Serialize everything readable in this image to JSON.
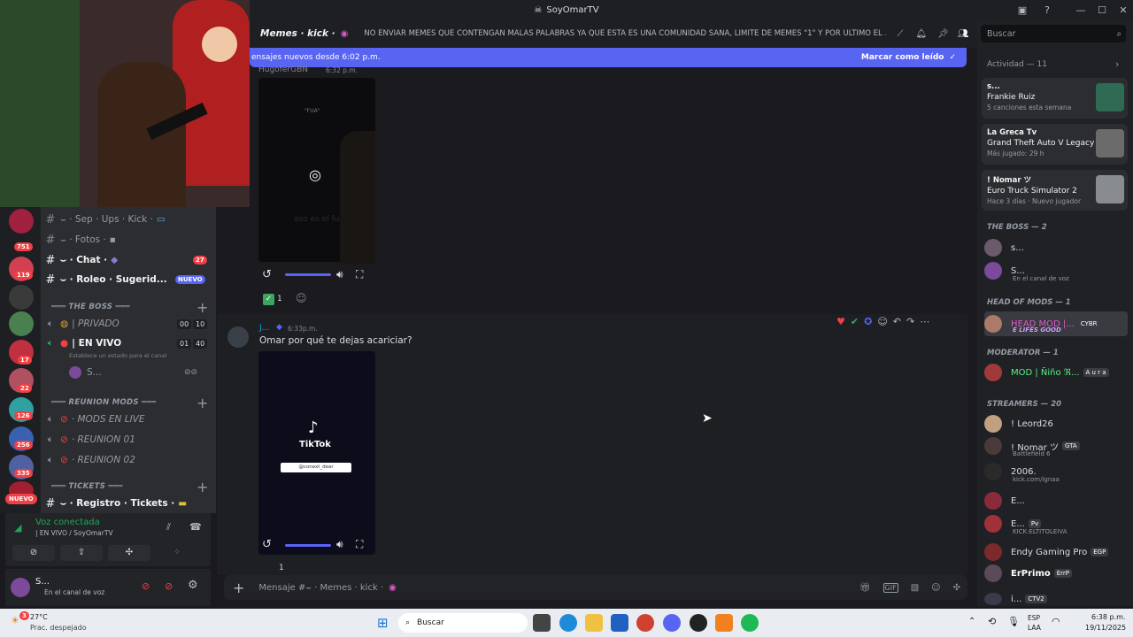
{
  "window": {
    "title": "SoyOmarTV"
  },
  "header": {
    "channel_name": "Memes · kick ·",
    "topic": "NO ENVIAR MEMES QUE CONTENGAN MALAS PALABRAS YA QUE ESTA ES UNA COMUNIDAD SANA, LIMITE DE MEMES \"1\" Y POR ULTIMO EL ..."
  },
  "search": {
    "placeholder": "Buscar"
  },
  "new_messages_bar": {
    "text": "ensajes nuevos desde 6:02 p.m.",
    "action": "Marcar como leído"
  },
  "servers": [
    {
      "badge": "751"
    },
    {
      "badge": "119"
    },
    {
      "badge": ""
    },
    {
      "badge": "17"
    },
    {
      "badge": "22"
    },
    {
      "badge": "126"
    },
    {
      "badge": "256"
    },
    {
      "badge": "335"
    },
    {
      "badge": "NUEVO"
    }
  ],
  "channels": [
    {
      "name": "⌣ · Sep · Ups · Kick ·",
      "badge": ""
    },
    {
      "name": "⌣ · Fotos ·",
      "badge": ""
    },
    {
      "name": "⌣ · Chat ·",
      "badge": "27"
    },
    {
      "name": "⌣ · Roleo · Sugerid...",
      "badge": "NUEVO"
    }
  ],
  "categories": {
    "boss": "═══ THE BOSS ═══",
    "reunion": "═══ REUNION MODS ═══",
    "tickets": "═══ TICKETS ═══"
  },
  "voice_channels": [
    {
      "name": "| PRIVADO",
      "c1": "00",
      "c2": "10"
    },
    {
      "name": "| EN VIVO",
      "c1": "01",
      "c2": "40"
    }
  ],
  "voice_status_hint": "Establece un estado para el canal",
  "voice_member": "S...",
  "reunion_channels": [
    "· MODS EN LIVE",
    "· REUNION 01",
    "· REUNION 02"
  ],
  "ticket_channel": "⌣ · Registro · Tickets ·",
  "voice_panel": {
    "status": "Voz conectada",
    "channel": "| EN VIVO / SoyOmarTV"
  },
  "user_panel": {
    "name": "S...",
    "status": "En el canal de voz"
  },
  "messages": [
    {
      "author": "HugoferGBN",
      "time": "6:32 p.m.",
      "text": "",
      "video_caption": "aso es el fua",
      "video_top": "\"FUA\"",
      "reaction_count": "1"
    },
    {
      "author": "J...",
      "time": "6:33p.m.",
      "text": "Omar por qué te dejas acariciar?",
      "video_brand": "TikTok",
      "video_handle": "@conext_dear",
      "reaction_count": "1"
    }
  ],
  "composer": {
    "placeholder": "Mensaje #⌣ · Memes · kick ·"
  },
  "activity": {
    "header": "Actividad — 11",
    "cards": [
      {
        "user": "s...",
        "title": "Frankie Ruiz",
        "sub": "5 canciones esta semana"
      },
      {
        "user": "La Greca Tv",
        "title": "Grand Theft Auto V Legacy",
        "sub": "Más jugado: 29 h"
      },
      {
        "user": "! Nomar ツ",
        "title": "Euro Truck Simulator 2",
        "sub": "Hace 3 días",
        "sub2": "Nuevo jugador"
      }
    ]
  },
  "member_sections": [
    {
      "title": "THE BOSS — 2"
    },
    {
      "title": "HEAD OF MODS — 1"
    },
    {
      "title": "MODERATOR — 1"
    },
    {
      "title": "STREAMERS — 20"
    }
  ],
  "members": {
    "boss": [
      {
        "name": "s...",
        "sub": ""
      },
      {
        "name": "S...",
        "sub": "En el canal de voz"
      }
    ],
    "head": [
      {
        "name": "HEAD MOD |...",
        "tag": "CYBR",
        "sub": "E LIFES GOOD"
      }
    ],
    "mod": [
      {
        "name": "MOD | Ñiño ℜ...",
        "tag": "A u r a"
      }
    ],
    "streamers": [
      {
        "name": "! Leord26",
        "tag": "",
        "sub": ""
      },
      {
        "name": "! Nomar ツ",
        "tag": "GTA",
        "sub": "Battlefield 6"
      },
      {
        "name": "2006.",
        "tag": "",
        "sub": "kick.com/ignaa"
      },
      {
        "name": "E...",
        "tag": "",
        "sub": ""
      },
      {
        "name": "E...",
        "tag": "Pv",
        "sub": "KICK:ELTITOLEIVA"
      },
      {
        "name": "Endy Gaming Pro",
        "tag": "EGP",
        "sub": ""
      },
      {
        "name": "ErPrimo",
        "tag": "ErrP",
        "sub": ""
      },
      {
        "name": "i...",
        "tag": "CTV2",
        "sub": ""
      }
    ]
  },
  "taskbar": {
    "weather_temp": "27°C",
    "weather_desc": "Prac. despejado",
    "search": "Buscar",
    "lang1": "ESP",
    "lang2": "LAA",
    "time": "6:38 p.m.",
    "date": "19/11/2025",
    "weather_badge": "3"
  },
  "colors": {
    "accent": "#5865f2",
    "danger": "#f23f43",
    "online": "#23a55a",
    "rail": "#1e1f22",
    "sidebar": "#2b2d31"
  }
}
